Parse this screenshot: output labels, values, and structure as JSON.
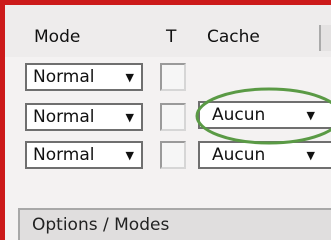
{
  "header": {
    "mode_label": "Mode",
    "t_label": "T",
    "cache_label": "Cache"
  },
  "rows": [
    {
      "mode": "Normal",
      "cache": ""
    },
    {
      "mode": "Normal",
      "cache": "Aucun"
    },
    {
      "mode": "Normal",
      "cache": "Aucun"
    }
  ],
  "footer": {
    "label": "Options / Modes"
  },
  "icons": {
    "dropdown": "caret-down-icon"
  },
  "colors": {
    "frame_border": "#cc1a1a",
    "highlight_ring": "#5a9a45"
  }
}
